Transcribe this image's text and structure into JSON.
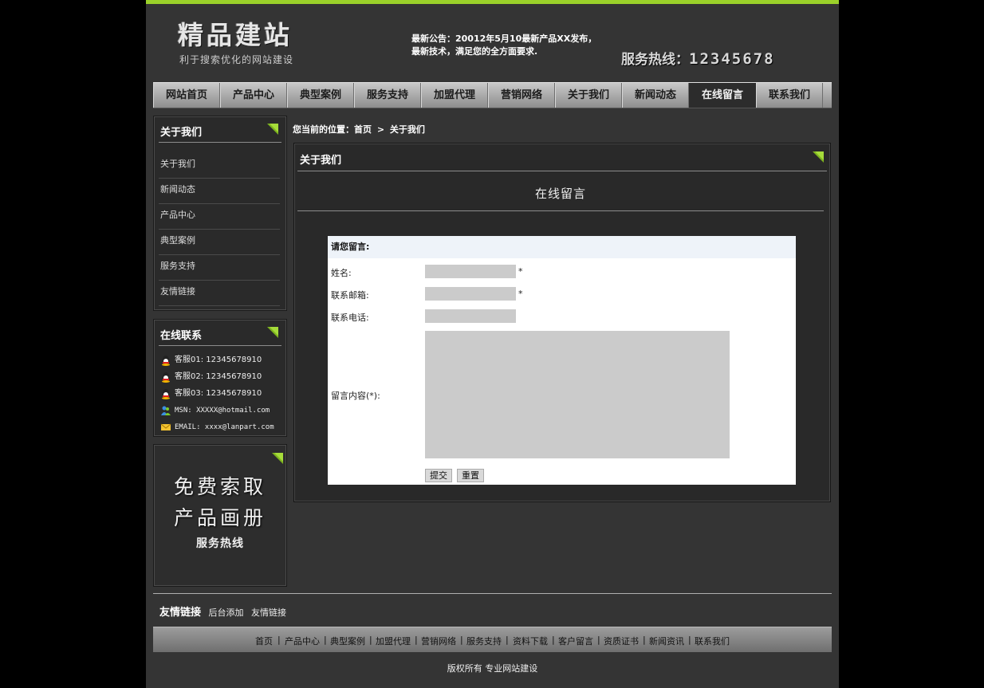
{
  "header": {
    "logo_title": "精品建站",
    "logo_subtitle": "利于搜索优化的网站建设",
    "notice_line1": "最新公告：20012年5月10最新产品XX发布，",
    "notice_line2": "最新技术，满足您的全方面要求.",
    "hotline_label": "服务热线：",
    "hotline_number": "12345678"
  },
  "nav": [
    "网站首页",
    "产品中心",
    "典型案例",
    "服务支持",
    "加盟代理",
    "营销网络",
    "关于我们",
    "新闻动态",
    "在线留言",
    "联系我们"
  ],
  "sidebar": {
    "about_title": "关于我们",
    "about_items": [
      "关于我们",
      "新闻动态",
      "产品中心",
      "典型案例",
      "服务支持",
      "友情链接"
    ],
    "contact_title": "在线联系",
    "contacts": [
      {
        "icon": "qq-icon",
        "text": "客服01: 12345678910"
      },
      {
        "icon": "qq-icon",
        "text": "客服02: 12345678910"
      },
      {
        "icon": "qq-icon",
        "text": "客服03: 12345678910"
      },
      {
        "icon": "msn-icon",
        "text": "MSN: XXXXX@hotmail.com"
      },
      {
        "icon": "email-icon",
        "text": "EMAIL: xxxx@lanpart.com"
      }
    ],
    "promo_line1": "免费索取",
    "promo_line2": "产品画册",
    "promo_line3": "服务热线"
  },
  "breadcrumb": {
    "label": "您当前的位置：",
    "home": "首页",
    "separator": ">",
    "current": "关于我们"
  },
  "main": {
    "box_title": "关于我们",
    "page_heading": "在线留言",
    "form": {
      "title": "请您留言:",
      "name_label": "姓名:",
      "email_label": "联系邮箱:",
      "phone_label": "联系电话:",
      "content_label": "留言内容(*):",
      "required_mark": "*",
      "submit_label": "提交",
      "reset_label": "重置",
      "name_value": "",
      "email_value": "",
      "phone_value": "",
      "content_value": ""
    }
  },
  "friend_links": {
    "title": "友情链接",
    "items": [
      "后台添加",
      "友情链接"
    ]
  },
  "footer": {
    "nav": [
      "首页",
      "产品中心",
      "典型案例",
      "加盟代理",
      "营销网络",
      "服务支持",
      "资料下载",
      "客户留言",
      "资质证书",
      "新闻资讯",
      "联系我们"
    ],
    "separator": "|",
    "copyright": "版权所有 专业网站建设"
  },
  "colors": {
    "accent": "#9bd12a",
    "page_bg": "#343434",
    "outer_bg": "#000000",
    "nav_active": "#2c2c2c"
  }
}
